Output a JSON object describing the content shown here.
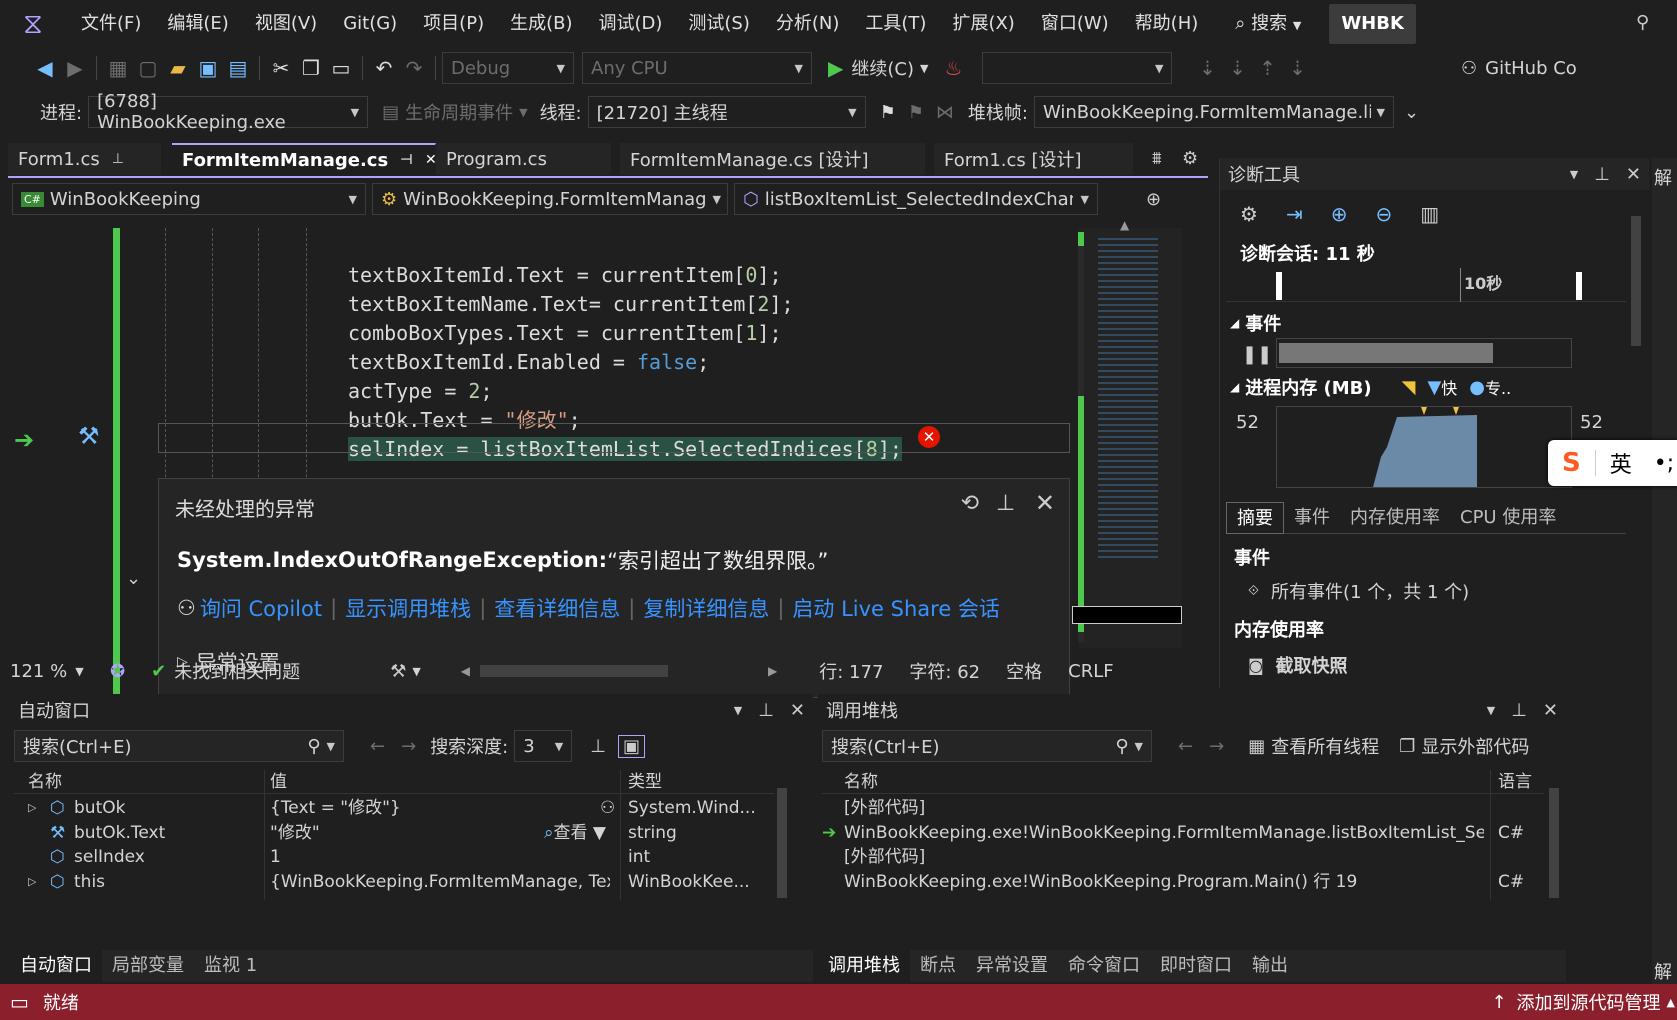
{
  "menu": {
    "items": [
      "文件(F)",
      "编辑(E)",
      "视图(V)",
      "Git(G)",
      "项目(P)",
      "生成(B)",
      "调试(D)",
      "测试(S)",
      "分析(N)",
      "工具(T)",
      "扩展(X)",
      "窗口(W)",
      "帮助(H)"
    ],
    "search_label": "搜索",
    "solution_badge": "WHBK"
  },
  "toolbar": {
    "config": "Debug",
    "platform": "Any CPU",
    "continue_label": "继续(C)",
    "github": "GitHub Co"
  },
  "debug_location": {
    "process_label": "进程:",
    "process_value": "[6788] WinBookKeeping.exe",
    "lifecycle_label": "生命周期事件",
    "thread_label": "线程:",
    "thread_value": "[21720] 主线程",
    "stackframe_label": "堆栈帧:",
    "stackframe_value": "WinBookKeeping.FormItemManage.lis"
  },
  "doc_tabs": [
    "Form1.cs",
    "FormItemManage.cs",
    "Program.cs",
    "FormItemManage.cs [设计]",
    "Form1.cs [设计]"
  ],
  "nav": {
    "project": "WinBookKeeping",
    "class": "WinBookKeeping.FormItemManag",
    "member": "listBoxItemList_SelectedIndexChan"
  },
  "exception": {
    "title": "未经处理的异常",
    "type": "System.IndexOutOfRangeException:",
    "message": "“索引超出了数组界限。”",
    "links": [
      "询问 Copilot",
      "显示调用堆栈",
      "查看详细信息",
      "复制详细信息",
      "启动 Live Share 会话"
    ],
    "settings": "异常设置"
  },
  "editor_status": {
    "zoom": "121 %",
    "issues": "未找到相关问题",
    "line": "行: 177",
    "char": "字符: 62",
    "spaces": "空格",
    "eol": "CRLF"
  },
  "diagnostics": {
    "title": "诊断工具",
    "session": "诊断会话: 11 秒",
    "timeline_tick": "10秒",
    "events_header": "事件",
    "memory_header": "进程内存 (MB)",
    "memory_legend_1": "快",
    "memory_legend_2": "专..",
    "memory_min_left": "52",
    "memory_min_right": "52",
    "tabs": [
      "摘要",
      "事件",
      "内存使用率",
      "CPU 使用率"
    ],
    "section_events": "事件",
    "all_events": "所有事件(1 个，共 1 个)",
    "section_memory": "内存使用率",
    "snapshot": "截取快照",
    "side_label": "解"
  },
  "ime": {
    "label": "英"
  },
  "autos": {
    "title": "自动窗口",
    "search_placeholder": "搜索(Ctrl+E)",
    "depth_label": "搜索深度:",
    "depth_value": "3",
    "columns": [
      "名称",
      "值",
      "类型"
    ],
    "rows": [
      {
        "name": "butOk",
        "value": "{Text = \"修改\"}",
        "type": "System.Wind..."
      },
      {
        "name": "butOk.Text",
        "value": "\"修改\"",
        "view": "查看",
        "type": "string"
      },
      {
        "name": "selIndex",
        "value": "1",
        "type": "int"
      },
      {
        "name": "this",
        "value": "{WinBookKeeping.FormItemManage, Text: 名...",
        "type": "WinBookKee..."
      }
    ],
    "tabs": [
      "自动窗口",
      "局部变量",
      "监视 1"
    ]
  },
  "callstack": {
    "title": "调用堆栈",
    "search_placeholder": "搜索(Ctrl+E)",
    "all_threads": "查看所有线程",
    "external_code": "显示外部代码",
    "columns": [
      "名称",
      "语言"
    ],
    "rows": [
      {
        "name": "[外部代码]",
        "lang": ""
      },
      {
        "name": "WinBookKeeping.exe!WinBookKeeping.FormItemManage.listBoxItemList_SelectedIndexC...",
        "lang": "C#"
      },
      {
        "name": "[外部代码]",
        "lang": ""
      },
      {
        "name": "WinBookKeeping.exe!WinBookKeeping.Program.Main() 行 19",
        "lang": "C#"
      }
    ],
    "tabs": [
      "调用堆栈",
      "断点",
      "异常设置",
      "命令窗口",
      "即时窗口",
      "输出"
    ]
  },
  "status": {
    "ready": "就绪",
    "source_control": "添加到源代码管理"
  },
  "colors": {
    "accent": "#b4a0ff",
    "status_bg": "#8b1f2c",
    "link": "#3794ff"
  }
}
